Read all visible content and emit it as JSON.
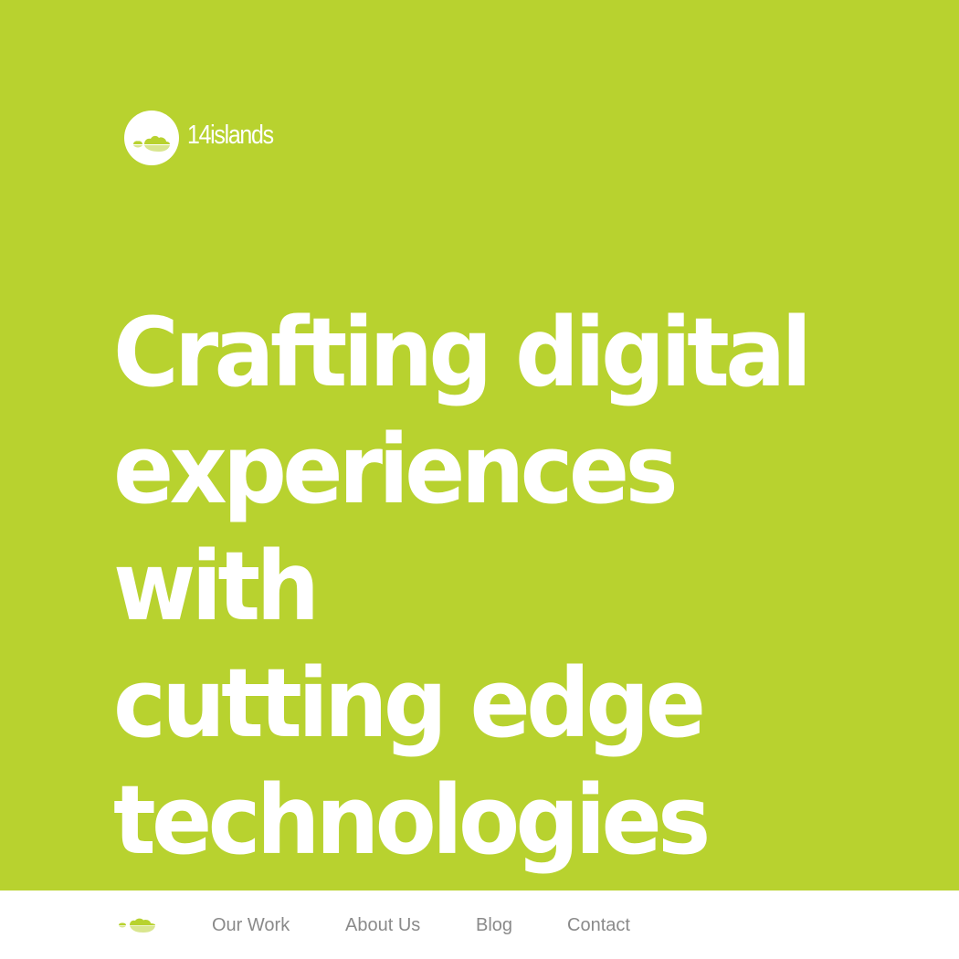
{
  "theme": {
    "brand_green": "#b8d22f",
    "nav_background": "#ffffff",
    "nav_text": "#8a8a8a",
    "headline_text": "#ffffff"
  },
  "header": {
    "logo_text": "14islands",
    "logo_icon": "islands-logo-icon"
  },
  "hero": {
    "headline_lines": [
      "Crafting digital",
      "experiences with",
      "cutting edge",
      "technologies"
    ]
  },
  "nav": {
    "logo_icon": "islands-small-logo-icon",
    "items": [
      {
        "label": "Our Work"
      },
      {
        "label": "About Us"
      },
      {
        "label": "Blog"
      },
      {
        "label": "Contact"
      }
    ]
  }
}
